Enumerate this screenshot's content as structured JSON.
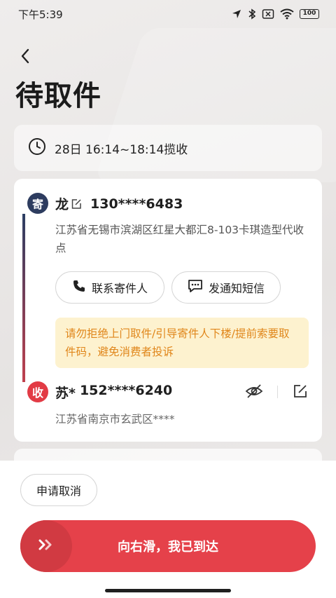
{
  "status_bar": {
    "time": "下午5:39",
    "battery": "100"
  },
  "header": {
    "title": "待取件"
  },
  "pickup_window": {
    "text": "28日 16:14~18:14揽收"
  },
  "sender": {
    "tag": "寄",
    "name": "龙",
    "phone": "130****6483",
    "address": "江苏省无锡市滨湖区红星大都汇8-103卡琪造型代收点"
  },
  "actions": {
    "contact_label": "联系寄件人",
    "sms_label": "发通知短信"
  },
  "notice": {
    "text": "请勿拒绝上门取件/引导寄件人下楼/提前索要取件码，避免消费者投诉"
  },
  "receiver": {
    "tag": "收",
    "name": "苏*",
    "phone": "152****6240",
    "address": "江苏省南京市玄武区****"
  },
  "bottom": {
    "cancel_label": "申请取消",
    "slide_label": "向右滑，我已到达"
  },
  "colors": {
    "accent_red": "#e5414a",
    "sender_navy": "#2d3c5f",
    "notice_bg": "#fdf2cf",
    "notice_text": "#e0861a"
  }
}
